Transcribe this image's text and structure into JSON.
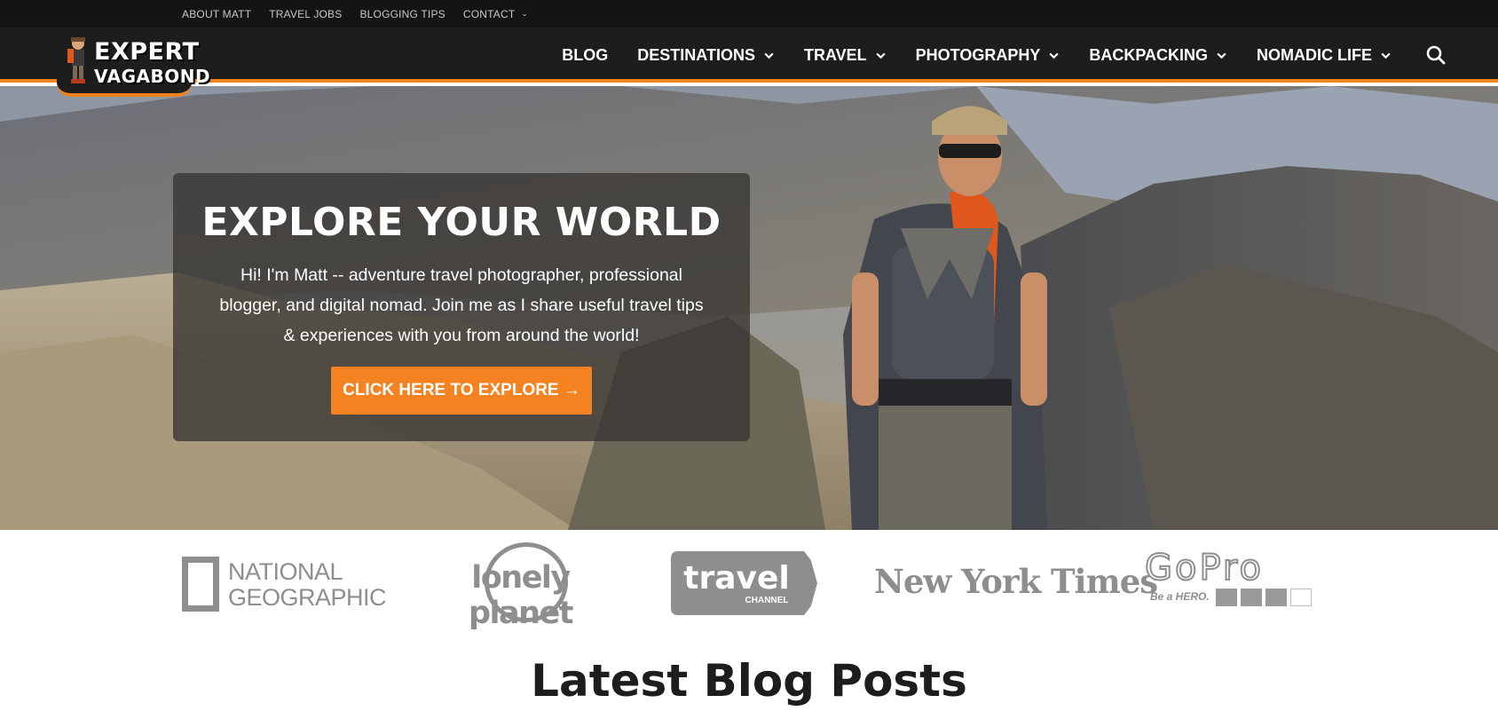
{
  "topbar": {
    "links": [
      "ABOUT MATT",
      "TRAVEL JOBS",
      "BLOGGING TIPS",
      "CONTACT"
    ]
  },
  "logo": {
    "line1": "EXPERT",
    "line2": "VAGABOND"
  },
  "nav": {
    "items": [
      "BLOG",
      "DESTINATIONS",
      "TRAVEL",
      "PHOTOGRAPHY",
      "BACKPACKING",
      "NOMADIC LIFE"
    ],
    "has_dropdown": [
      false,
      true,
      true,
      true,
      true,
      true
    ],
    "search_icon": "search-icon"
  },
  "hero": {
    "title": "EXPLORE YOUR WORLD",
    "text": "Hi! I'm Matt -- adventure travel photographer, professional blogger, and digital nomad. Join me as I share useful travel tips & experiences with you from around the world!",
    "cta": "CLICK HERE TO EXPLORE →"
  },
  "press": {
    "natgeo_1": "NATIONAL",
    "natgeo_2": "GEOGRAPHIC",
    "lonely_planet": "lonely planet",
    "travel_1": "travel",
    "travel_2": "CHANNEL",
    "nyt": "New York Times",
    "gopro": "GoPro",
    "gopro_tag": "Be a HERO."
  },
  "section": {
    "title": "Latest Blog Posts"
  },
  "colors": {
    "accent": "#f58220",
    "nav_bg": "#1d1d1d",
    "topbar_bg": "#141414",
    "press_gray": "#8e8e8e"
  }
}
